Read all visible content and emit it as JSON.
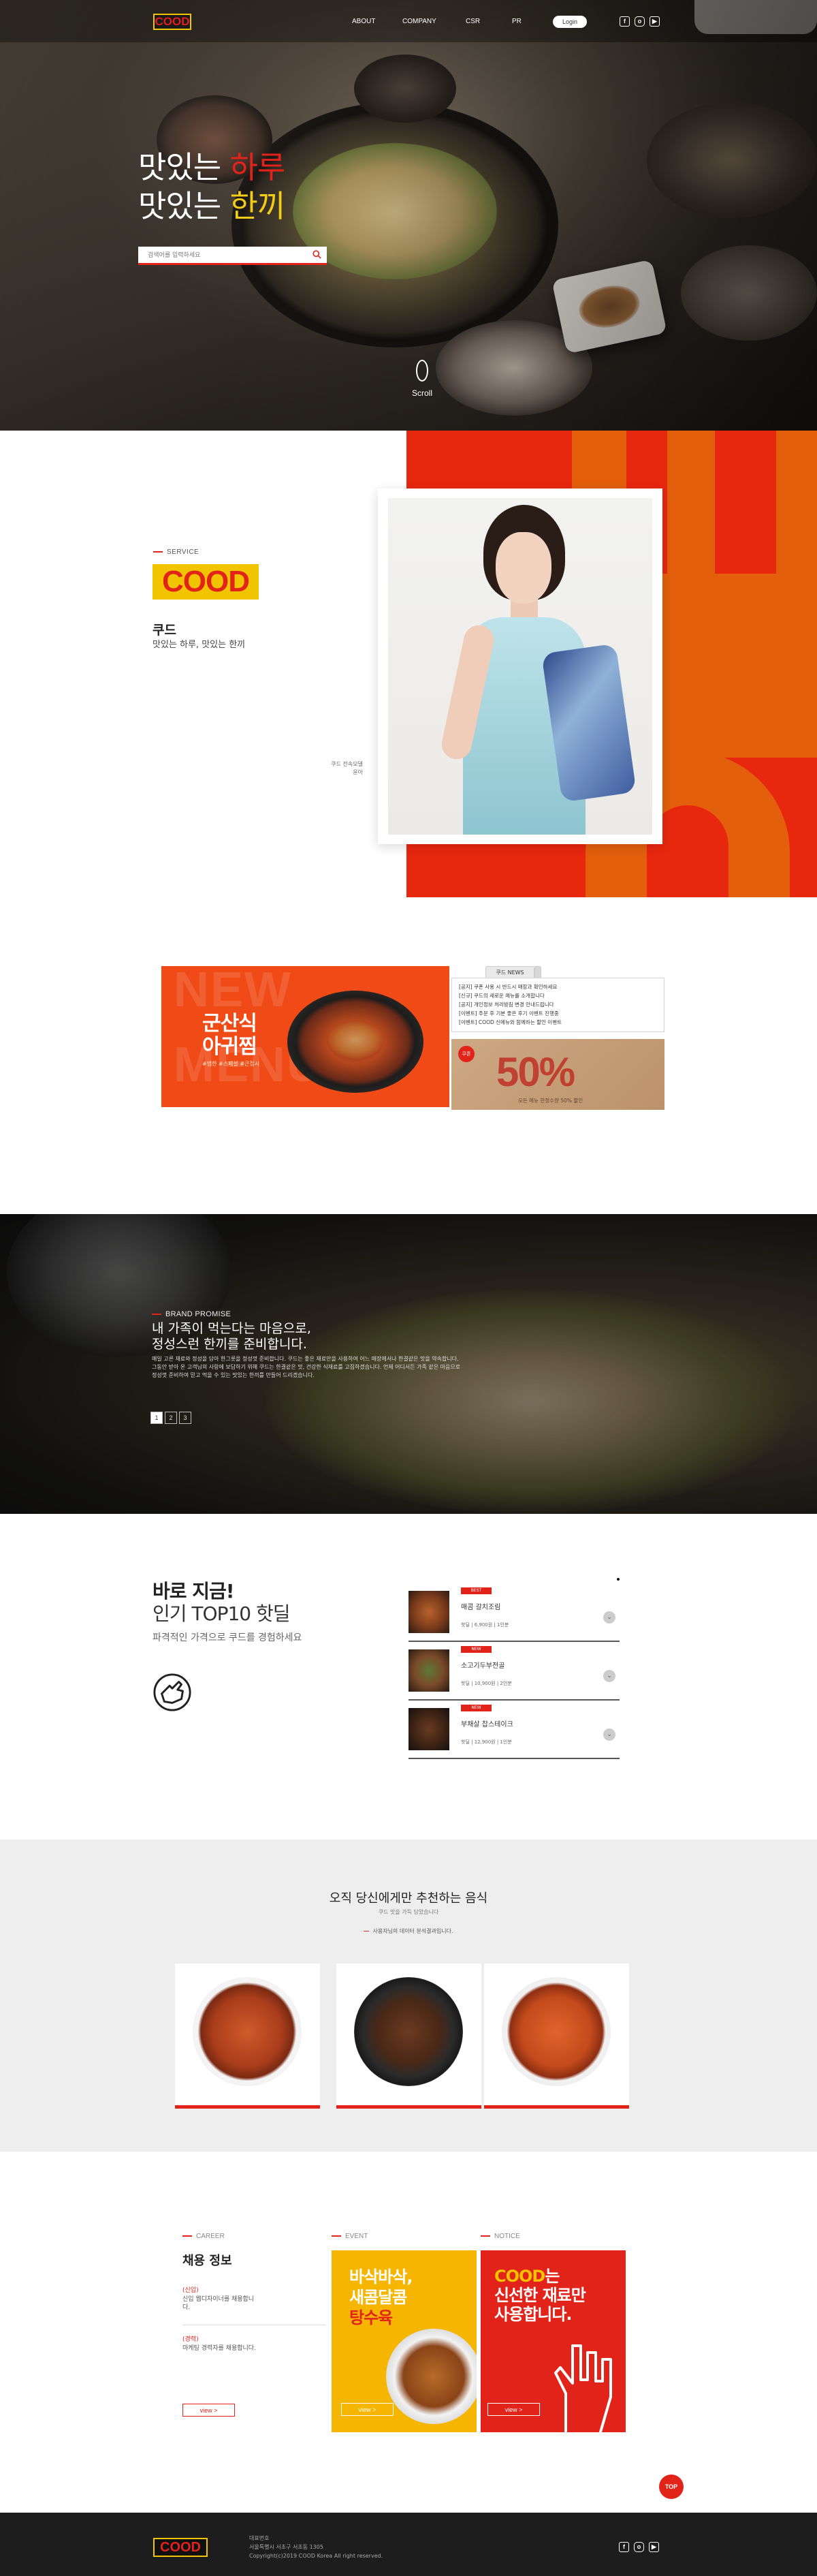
{
  "header": {
    "logo": "COOD",
    "nav": [
      "ABOUT",
      "COMPANY",
      "CSR",
      "PR"
    ],
    "login": "Login",
    "social_icons": [
      "facebook-icon",
      "instagram-icon",
      "youtube-icon"
    ]
  },
  "hero": {
    "title_line1_a": "맛있는 ",
    "title_line1_b": "하루",
    "title_line2_a": "맛있는 ",
    "title_line2_b": "한끼",
    "search_placeholder": "검색어를 입력하세요",
    "scroll_label": "Scroll"
  },
  "service": {
    "label": "SERVICE",
    "logo": "COOD",
    "name": "쿠드",
    "slogan": "맛있는 하루, 맛있는 한끼",
    "caption_line1": "쿠드 전속모델",
    "caption_line2": "윤아"
  },
  "promo": {
    "bg_word1": "NEW",
    "bg_word2": "MENU",
    "menu_title_line1": "군산식",
    "menu_title_line2": "아귀찜",
    "menu_sub": "#맵한 #스페셜 #큰접시",
    "notice_tab": "쿠드 NEWS",
    "notice_items": [
      "[공지] 쿠폰 사용 시 반드시 매장과 확인하세요",
      "[신규] 쿠드의 새로운 메뉴를 소개합니다",
      "[공지] 개인정보 처리방침 변경 안내드립니다",
      "[이벤트] 주문 후 기분 좋은 후기 이벤트 진행중",
      "[이벤트] COOD 신메뉴와 함께하는 할인 이벤트"
    ],
    "coupon_badge": "쿠폰",
    "coupon_value": "50%",
    "coupon_note": "모든 메뉴 한정수량 50% 할인"
  },
  "brand": {
    "label": "BRAND PROMISE",
    "title_line1": "내 가족이 먹는다는 마음으로,",
    "title_line2": "정성스런 한끼를 준비합니다.",
    "text": "매일 고른 재료와 정성을 담아 한그릇을 정성껏 준비합니다. 쿠드는 좋은 재료만을 사용하여 어느 매장에서나 한결같은 맛을 약속합니다. 그동안 받아 온 고객님의 사랑에 보답하기 위해 쿠드는 한결같은 맛, 건강한 식재료를 고집하겠습니다. 언제 어디서든 가족 같은 마음으로 정성껏 준비하여 믿고 먹을 수 있는 맛있는 한끼를 만들어 드리겠습니다.",
    "pages": [
      "1",
      "2",
      "3"
    ]
  },
  "top10": {
    "line1": "바로 지금!",
    "line2": "인기 TOP10 핫딜",
    "sub": "파격적인 가격으로 쿠드를 경험하세요",
    "items": [
      {
        "badge": "BEST",
        "name": "매콤 갈치조림",
        "meta": "핫딜 | 6,900원 | 1인분"
      },
      {
        "badge": "NEW",
        "name": "소고기두부전골",
        "meta": "핫딜 | 10,900원 | 2인분"
      },
      {
        "badge": "NEW",
        "name": "부채살 찹스테이크",
        "meta": "핫딜 | 12,900원 | 1인분"
      }
    ]
  },
  "recommend": {
    "title": "오직 당신에게만 추천하는 음식",
    "sub1": "쿠드 맛을 가득 담았습니다",
    "sub2": "사용자님의 데이터 분석결과입니다."
  },
  "info": {
    "career_label": "CAREER",
    "career_title": "채용 정보",
    "career_head1": "(신입)",
    "career_text1": "신입 웹디자이너를 채용합니다.",
    "career_head2": "(경력)",
    "career_text2": "마케팅 경력자를 채용합니다.",
    "event_label": "EVENT",
    "event_line1": "바삭바삭,",
    "event_line2": "새콤달콤",
    "event_line3": "탕수육",
    "notice_label": "NOTICE",
    "notice_word": "COOD",
    "notice_line1": "는",
    "notice_line2": "신선한 재료만",
    "notice_line3": "사용합니다.",
    "view": "view >"
  },
  "top_button": "TOP",
  "footer": {
    "logo": "COOD",
    "line1": "대표번호",
    "line2": "서울특별시 서초구 서초동 1305",
    "line3": "Copyright(c)2019 COOD Korea All right reserved."
  },
  "colors": {
    "brand_red": "#e2231a",
    "brand_yellow": "#f2c400",
    "brand_orange": "#e35f0c"
  }
}
